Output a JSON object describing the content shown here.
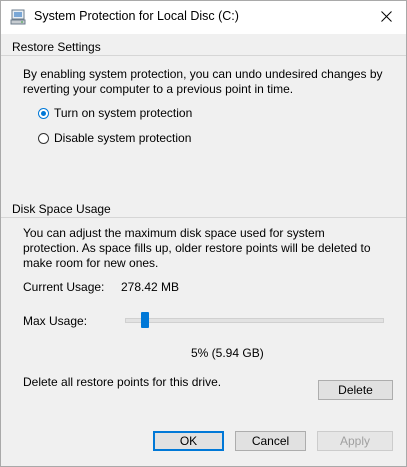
{
  "window": {
    "title": "System Protection for Local Disc (C:)",
    "close_glyph": "✕"
  },
  "restore_settings": {
    "heading": "Restore Settings",
    "description": "By enabling system protection, you can undo undesired changes by reverting your computer to a previous point in time.",
    "options": [
      {
        "label": "Turn on system protection",
        "selected": true
      },
      {
        "label": "Disable system protection",
        "selected": false
      }
    ]
  },
  "disk_space": {
    "heading": "Disk Space Usage",
    "description": "You can adjust the maximum disk space used for system protection. As space fills up, older restore points will be deleted to make room for new ones.",
    "current_usage_label": "Current Usage:",
    "current_usage_value": "278.42 MB",
    "max_usage_label": "Max Usage:",
    "max_usage_percent": 5,
    "max_usage_readout": "5% (5.94 GB)",
    "delete_text": "Delete all restore points for this drive.",
    "delete_button": "Delete"
  },
  "footer": {
    "ok": "OK",
    "cancel": "Cancel",
    "apply": "Apply"
  },
  "colors": {
    "accent": "#0078d7",
    "dialog_bg": "#f0f0f0"
  },
  "icons": {
    "title": "drive-protection-icon",
    "close": "close-icon"
  }
}
